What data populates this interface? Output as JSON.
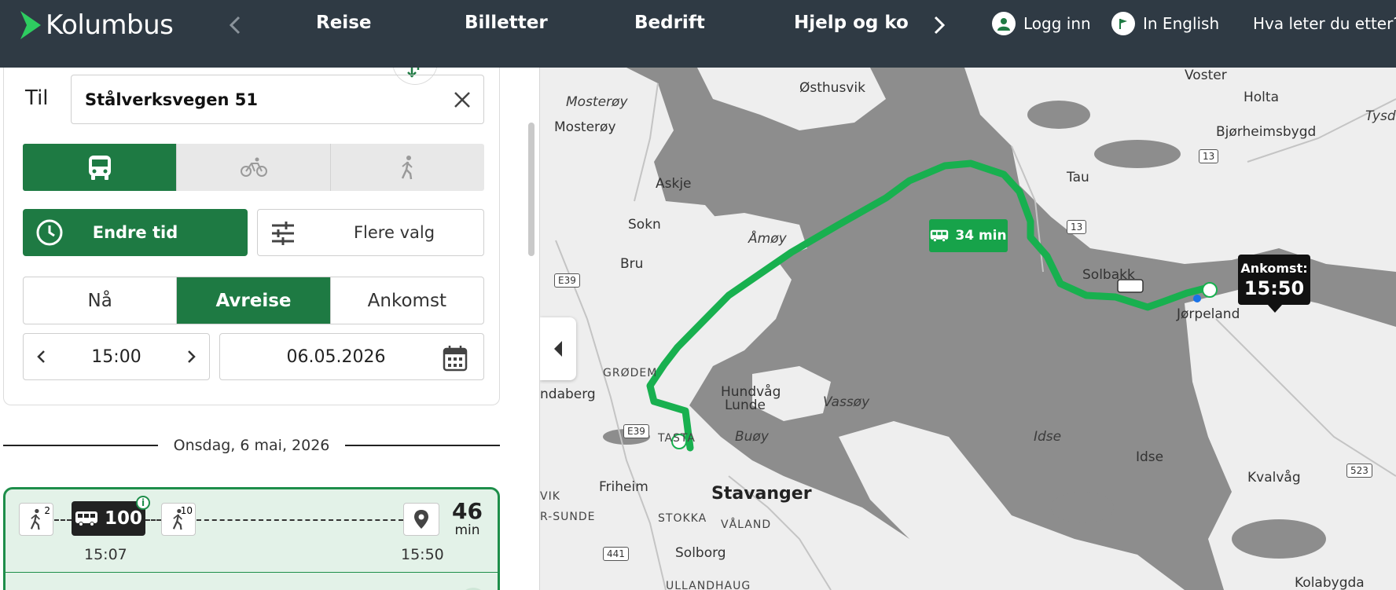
{
  "header": {
    "brand": "Kolumbus",
    "nav": [
      "Reise",
      "Billetter",
      "Bedrift",
      "Hjelp og kon"
    ],
    "login": "Logg inn",
    "language": "In English",
    "search_prompt": "Hva leter du etter?"
  },
  "form": {
    "to_label": "Til",
    "to_value": "Stålverksvegen 51",
    "modes": [
      "bus-icon",
      "bicycle-icon",
      "walk-icon"
    ],
    "active_mode": "bus-icon",
    "change_time": "Endre tid",
    "more_options": "Flere valg",
    "time_modes": [
      "Nå",
      "Avreise",
      "Ankomst"
    ],
    "active_time_mode": "Avreise",
    "time": "15:00",
    "date": "06.05.2026"
  },
  "results": {
    "date_header": "Onsdag, 6 mai, 2026",
    "trip": {
      "walk_start_minutes": "2",
      "route": "100",
      "walk_end_minutes": "10",
      "depart": "15:07",
      "arrive": "15:50",
      "duration": "46",
      "duration_unit": "min"
    }
  },
  "map": {
    "segment_duration": "34 min",
    "arrival_label": "Ankomst:",
    "arrival_time": "15:50",
    "places": [
      "Østhusvik",
      "Mosterøy",
      "Mosterøy",
      "Askje",
      "Sokn",
      "Bru",
      "Åmøy",
      "Tau",
      "Voster",
      "Holta",
      "Bjørheimsbygd",
      "Solbakk",
      "Jørpeland",
      "GRØDEM",
      "Hundvåg",
      "Lunde",
      "Vassøy",
      "ndaberg",
      "TASTA",
      "Buøy",
      "Friheim",
      "Stavanger",
      "VIK",
      "R-SUNDE",
      "STOKKA",
      "VÅLAND",
      "Solborg",
      "ULLANDHAUG",
      "Idse",
      "Idse",
      "Kvalvåg",
      "Kolabygda",
      "Tysd"
    ],
    "roads": [
      "E39",
      "E39",
      "13",
      "13",
      "441",
      "523"
    ],
    "colors": {
      "route": "#18b04f",
      "land": "#eeeeee",
      "water": "#8d8d8d",
      "brand": "#1e7a43"
    }
  }
}
